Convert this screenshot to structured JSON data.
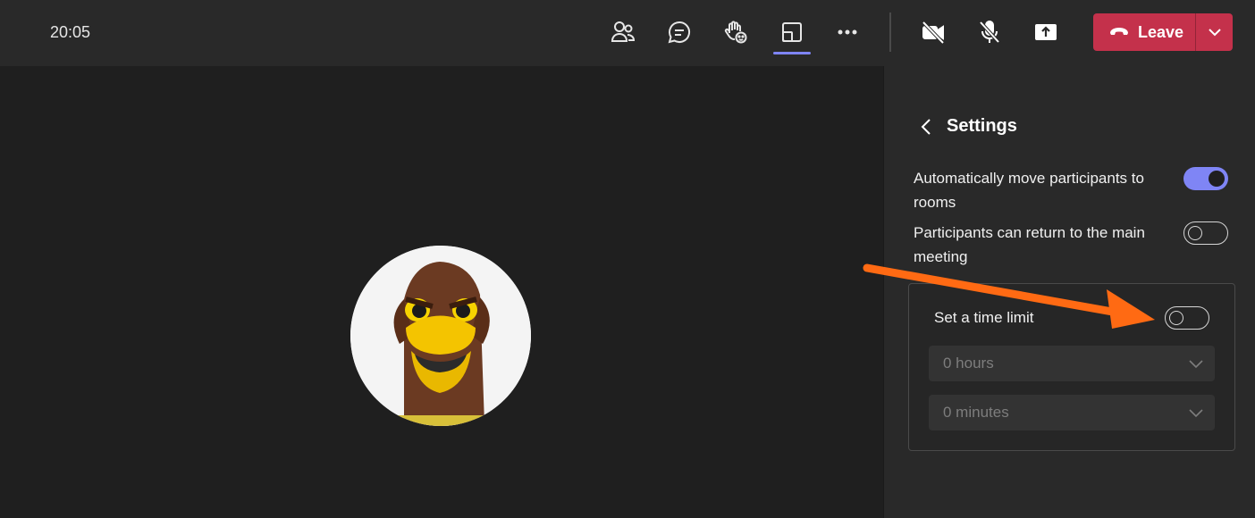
{
  "header": {
    "time": "20:05",
    "toolbar_icons": [
      "people-icon",
      "chat-icon",
      "raise-hand-icon",
      "rooms-icon",
      "more-icon",
      "camera-off-icon",
      "mic-off-icon",
      "share-icon"
    ],
    "leave_label": "Leave"
  },
  "panel": {
    "title": "Settings",
    "options": [
      {
        "label": "Automatically move participants to rooms",
        "enabled": true
      },
      {
        "label": "Participants can return to the main meeting",
        "enabled": false
      }
    ],
    "time_limit": {
      "label": "Set a time limit",
      "enabled": false,
      "hours": "0 hours",
      "minutes": "0 minutes"
    }
  },
  "colors": {
    "accent": "#7f85f5",
    "leave": "#c4314b",
    "annotation_arrow": "#ff6a13"
  }
}
